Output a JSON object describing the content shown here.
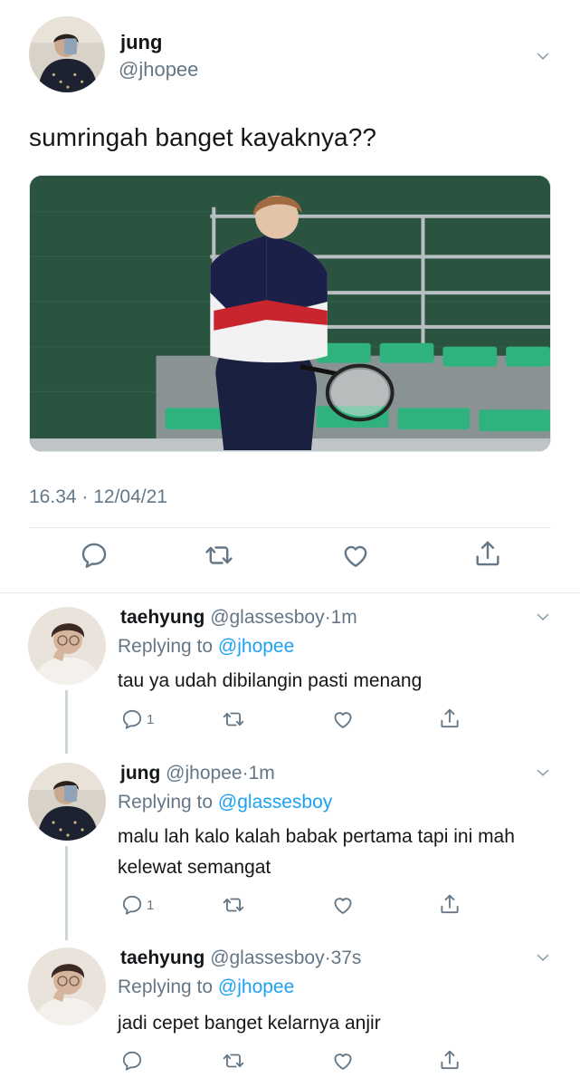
{
  "main_tweet": {
    "name": "jung",
    "handle": "@jhopee",
    "text": "sumringah banget kayaknya??",
    "timestamp": "16.34 · 12/04/21",
    "icons": [
      "reply-icon",
      "retweet-icon",
      "like-icon",
      "share-icon"
    ]
  },
  "replies": [
    {
      "name": "taehyung",
      "handle": "@glassesboy",
      "dot": "·",
      "time": "1m",
      "replying_prefix": "Replying to ",
      "replying_to": "@jhopee",
      "text": "tau ya udah dibilangin pasti menang",
      "reply_count": "1"
    },
    {
      "name": "jung",
      "handle": "@jhopee",
      "dot": "·",
      "time": "1m",
      "replying_prefix": "Replying to ",
      "replying_to": "@glassesboy",
      "text": "malu lah kalo kalah babak pertama tapi ini mah kelewat semangat",
      "reply_count": "1"
    },
    {
      "name": "taehyung",
      "handle": "@glassesboy",
      "dot": "·",
      "time": "37s",
      "replying_prefix": "Replying to ",
      "replying_to": "@jhopee",
      "text": "jadi cepet banget kelarnya anjir",
      "reply_count": ""
    }
  ],
  "colors": {
    "text": "#14171a",
    "secondary": "#657786",
    "link": "#1da1f2",
    "divider": "#e1e8ed"
  }
}
